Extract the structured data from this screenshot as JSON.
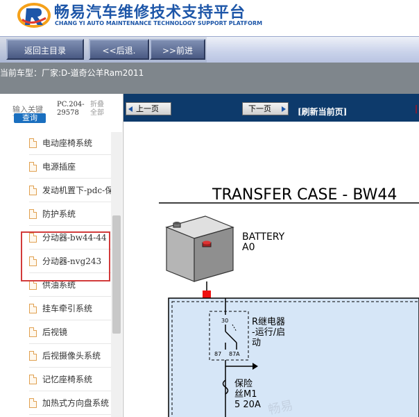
{
  "header": {
    "title_cn": "畅易汽车维修技术支持平台",
    "title_en": "CHANG YI AUTO MAINTENANCE TECHNOLOGY SUPPORT PLATFORM"
  },
  "toolbar": {
    "home_label": "返回主目录",
    "back_label": "<<后退.",
    "forward_label": ">>前进"
  },
  "infobar": {
    "label": "当前车型：",
    "vehicle": "厂家:D-道奇公羊Ram2011"
  },
  "sidebar": {
    "search_placeholder": "输入关键",
    "search_button": "查询",
    "pc_line1": "PC.204-",
    "pc_line2": "29578",
    "fold_line1": "折叠",
    "fold_line2": "全部",
    "items": [
      {
        "label": "电动座椅系统"
      },
      {
        "label": "电源插座"
      },
      {
        "label": "发动机置下-pdc-保"
      },
      {
        "label": "防护系统"
      },
      {
        "label": "分动器-bw44-44"
      },
      {
        "label": "分动器-nvg243"
      },
      {
        "label": "供油系统"
      },
      {
        "label": "挂车牵引系统"
      },
      {
        "label": "后视镜"
      },
      {
        "label": "后视摄像头系统"
      },
      {
        "label": "记忆座椅系统"
      },
      {
        "label": "加热式方向盘系统"
      }
    ]
  },
  "pager": {
    "prev_label": "上一页",
    "next_label": "下一页",
    "refresh_label": "[刷新当前页]"
  },
  "diagram": {
    "title": "TRANSFER CASE - BW44",
    "battery_label": "BATTERY",
    "battery_id": "A0",
    "relay_label_1": "R继电器",
    "relay_label_2": "-运行/启",
    "relay_label_3": "动",
    "pin_30": "30",
    "pin_87": "87",
    "pin_87a": "87A",
    "fuse_label_1": "保险",
    "fuse_label_2": "丝M1",
    "fuse_label_3": "5 20A",
    "watermark": "畅易"
  },
  "colors": {
    "brand_blue": "#1d56a8",
    "pager_bg": "#0d3a6b",
    "highlight_red": "#d23a3a",
    "diagram_fill": "#d6e6f7"
  }
}
